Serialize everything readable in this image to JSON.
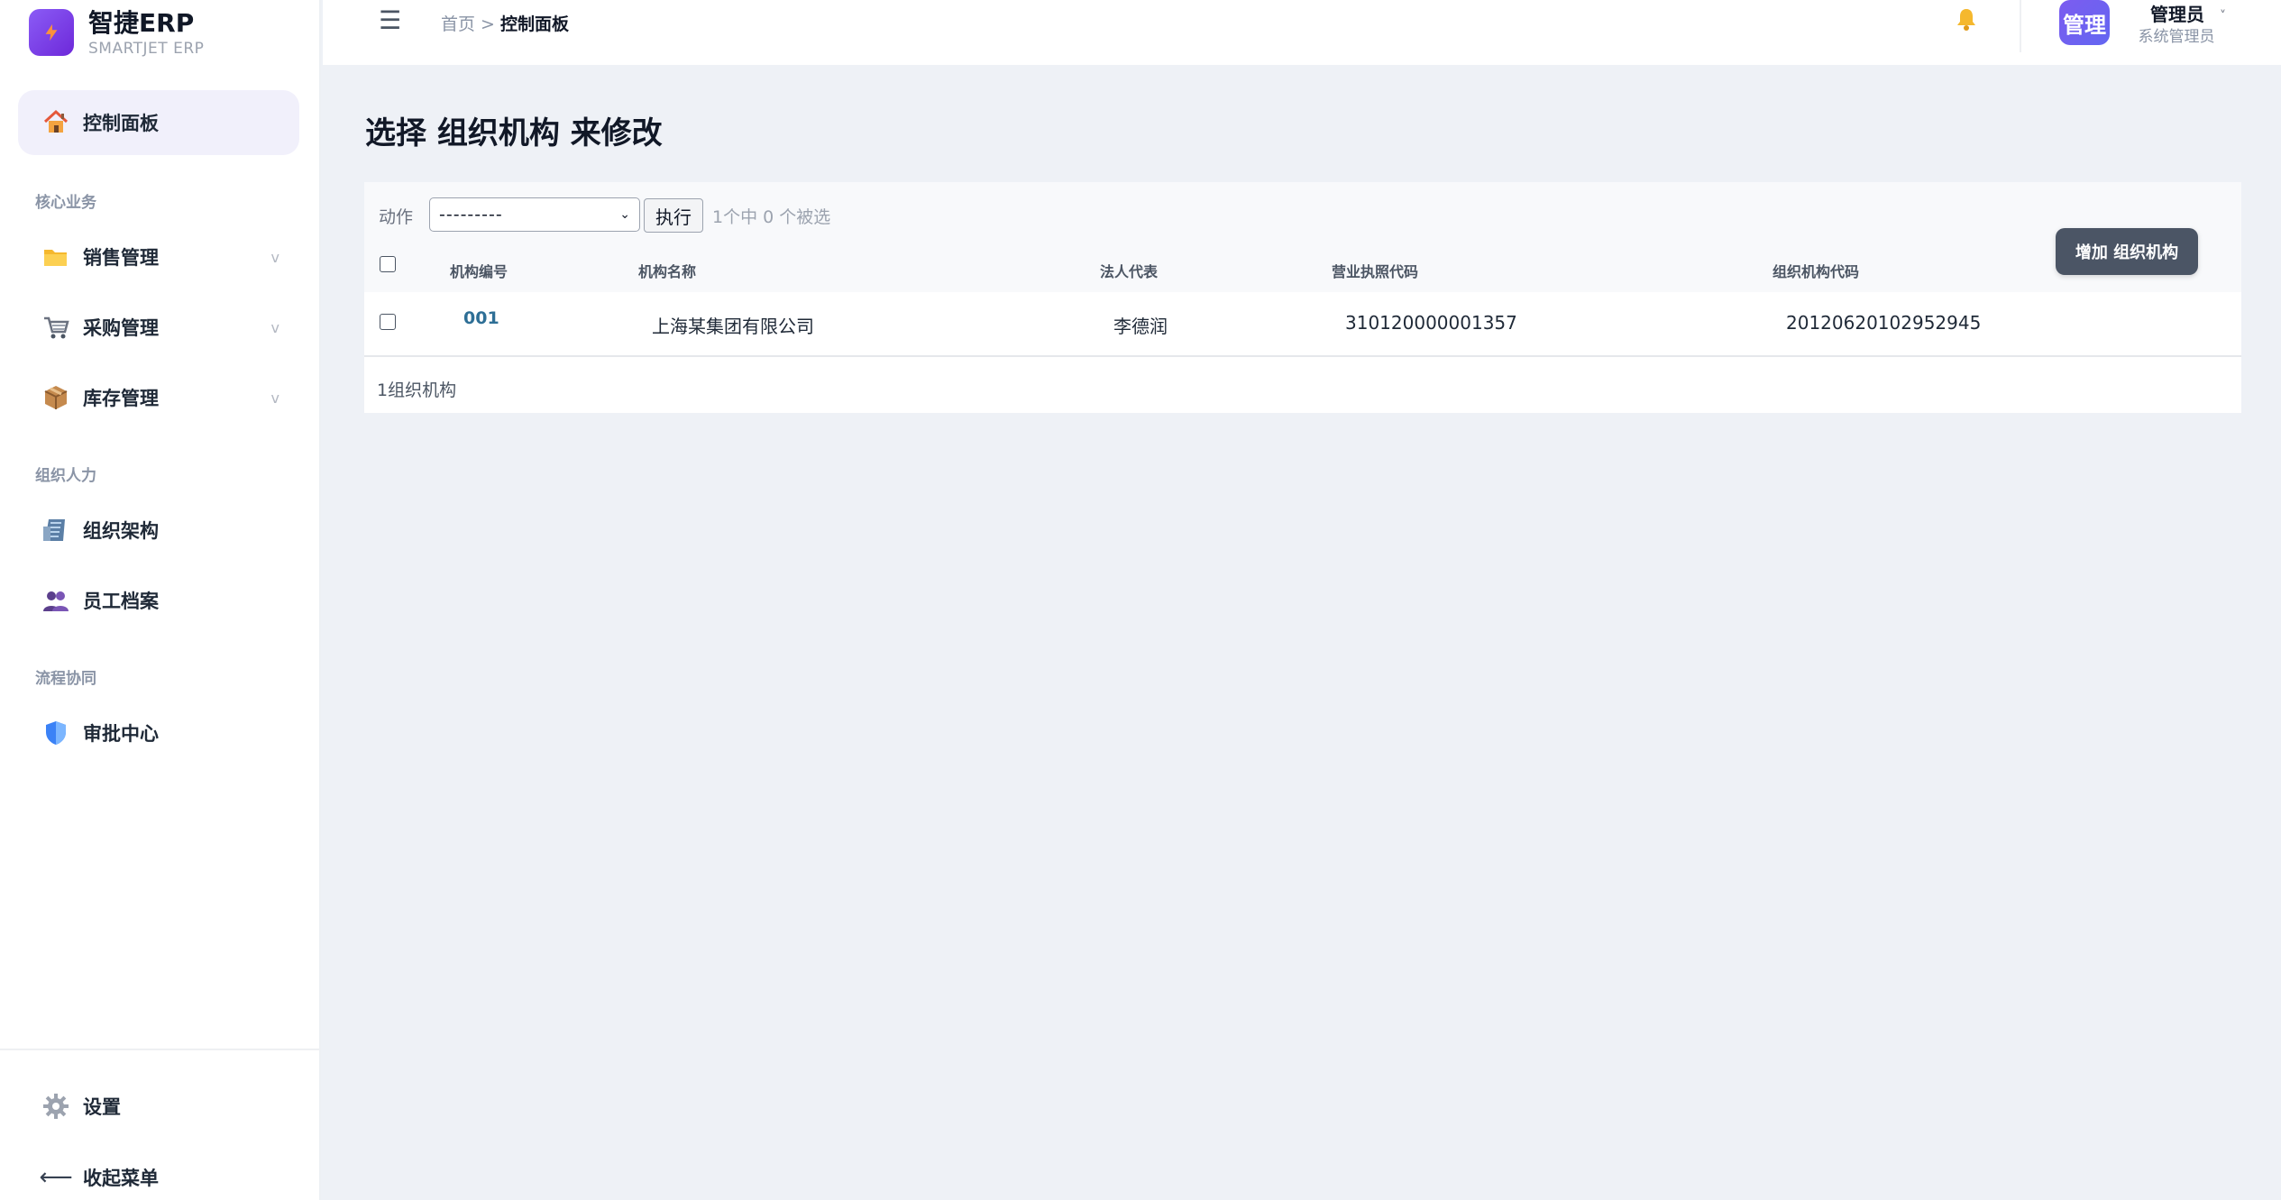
{
  "brand": {
    "name": "智捷ERP",
    "subtitle": "SMARTJET ERP"
  },
  "sidebar": {
    "dashboard": {
      "label": "控制面板",
      "icon": "house-icon"
    },
    "sections": [
      {
        "title": "核心业务"
      },
      {
        "title": "组织人力"
      },
      {
        "title": "流程协同"
      }
    ],
    "items": [
      {
        "label": "销售管理",
        "icon": "folder-icon",
        "expandable": true
      },
      {
        "label": "采购管理",
        "icon": "shopping-cart-icon",
        "expandable": true
      },
      {
        "label": "库存管理",
        "icon": "package-icon",
        "expandable": true
      },
      {
        "label": "组织架构",
        "icon": "building-icon",
        "expandable": false
      },
      {
        "label": "员工档案",
        "icon": "people-icon",
        "expandable": false
      },
      {
        "label": "审批中心",
        "icon": "shield-icon",
        "expandable": false
      }
    ],
    "chevron": "v",
    "settings": {
      "label": "设置",
      "icon": "gear-icon"
    },
    "collapse": {
      "label": "收起菜单",
      "icon": "arrow-left-icon",
      "glyph": "⟵"
    }
  },
  "topbar": {
    "menu_glyph": "☰",
    "breadcrumb": {
      "home": "首页",
      "separator": ">",
      "current": "控制面板"
    },
    "user": {
      "avatar_text": "管理",
      "name": "管理员",
      "role": "系统管理员",
      "caret": "˅"
    }
  },
  "main": {
    "title": "选择 组织机构 来修改",
    "add_button": "增加 组织机构",
    "actions": {
      "label": "动作",
      "selected": "---------",
      "run_button": "执行",
      "selection_count": "1个中 0 个被选"
    },
    "table": {
      "columns": [
        "机构编号",
        "机构名称",
        "法人代表",
        "营业执照代码",
        "组织机构代码"
      ],
      "rows": [
        [
          "001",
          "上海某集团有限公司",
          "李德润",
          "310120000001357",
          "20120620102952945"
        ]
      ],
      "footer": "1组织机构"
    }
  },
  "colors": {
    "accent": "#7c5cf0",
    "link": "#2e6f96",
    "add_button_bg": "#4b5565",
    "page_bg": "#eef1f6"
  }
}
